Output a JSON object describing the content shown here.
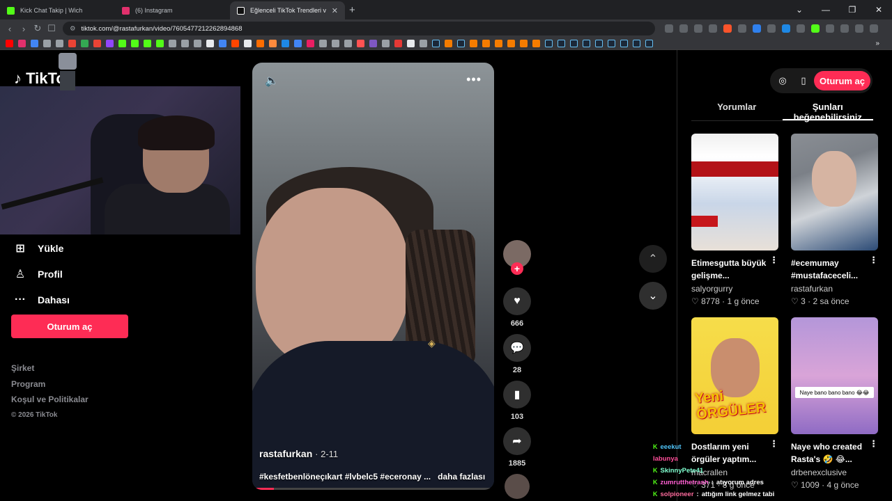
{
  "browser": {
    "tabs": [
      {
        "title": "Kick Chat Takip | Wich",
        "color": "#53fc18"
      },
      {
        "title": "(6) Instagram",
        "color": "#e1306c"
      },
      {
        "title": "Eğlenceli TikTok Trendleri ve",
        "color": "#ffffff"
      }
    ],
    "new_tab": "+",
    "url": "tiktok.com/@rastafurkan/video/7605477212262894868"
  },
  "sidebar": {
    "logo": "TikTok",
    "items": [
      {
        "label": "Yükle",
        "icon": "upload-icon"
      },
      {
        "label": "Profil",
        "icon": "profile-icon"
      },
      {
        "label": "Dahası",
        "icon": "more-icon"
      }
    ],
    "login_button": "Oturum aç",
    "footer": [
      "Şirket",
      "Program",
      "Koşul ve Politikalar"
    ],
    "copyright": "© 2026 TikTok"
  },
  "video": {
    "username": "rastafurkan",
    "date": "· 2-11",
    "description": "#kesfetbenlöneçıkart #lvbelc5 #eceronay ...",
    "more_label": "daha fazlası",
    "progress": 0.09
  },
  "actions": [
    {
      "name": "like",
      "icon": "heart-icon",
      "count": "666"
    },
    {
      "name": "comment",
      "icon": "comment-icon",
      "count": "28"
    },
    {
      "name": "bookmark",
      "icon": "bookmark-icon",
      "count": "103"
    },
    {
      "name": "share",
      "icon": "share-icon",
      "count": "1885"
    }
  ],
  "right_panel": {
    "login": "Oturum aç",
    "tabs": [
      "Yorumlar",
      "Şunları beğenebilirsiniz"
    ],
    "cards": [
      {
        "title": "Etimesgutta büyük gelişme...",
        "author": "salyorgurry",
        "likes": "8778",
        "age": "1 g önce"
      },
      {
        "title": "#ecemumay #mustafaceceli...",
        "author": "rastafurkan",
        "likes": "3",
        "age": "2 sa önce"
      },
      {
        "title": "Dostlarım yeni örgüler yaptım...",
        "author": "macrallen",
        "likes": "371",
        "age": "8 g önce"
      },
      {
        "title": "Naye who created Rasta's 🤣 😂...",
        "author": "drbenexclusive",
        "likes": "1009",
        "age": "4 g önce"
      }
    ],
    "thumb_texts": {
      "card3": "Yeni ÖRGÜLER",
      "card4": "Naye bano bano bano 😂😂"
    }
  },
  "chat": [
    {
      "user": "eeekut",
      "color": "#4fc3f7",
      "msg": ""
    },
    {
      "user": "labunya",
      "color": "#ff4f9a",
      "msg": ""
    },
    {
      "user": "SkinnyPete41",
      "color": "#80ffd0",
      "msg": ""
    },
    {
      "user": "zumrutthetrash",
      "color": "#ff5fd2",
      "msg": "atıyorum adres"
    },
    {
      "user": "solpioneer",
      "color": "#ff6b9d",
      "msg": "attığım link gelmez tabi"
    }
  ]
}
